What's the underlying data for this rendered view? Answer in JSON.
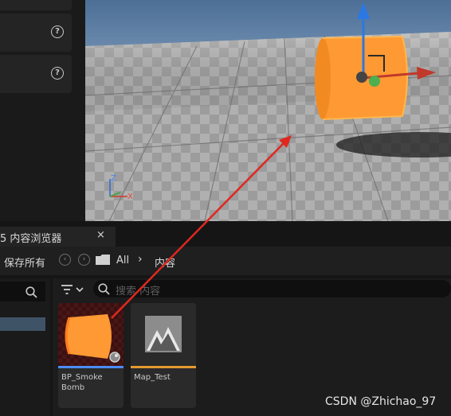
{
  "details_panel": {
    "help_glyph": "?"
  },
  "viewport": {
    "axis_z": "Z",
    "axis_x": "X"
  },
  "content_browser": {
    "tab_label": "5 内容浏览器",
    "close_glyph": "×",
    "save_all": "保存所有",
    "breadcrumb": [
      "All",
      "内容"
    ],
    "breadcrumb_separator": "›",
    "search_placeholder": "搜索 内容",
    "assets": [
      {
        "name": "BP_Smoke Bomb",
        "type": "blueprint",
        "bar_color": "#4a8cff"
      },
      {
        "name": "Map_Test",
        "type": "level",
        "bar_color": "#e39a2f"
      }
    ]
  },
  "watermark": "CSDN @Zhichao_97",
  "colors": {
    "accent_orange": "#ff9933",
    "annotation_arrow": "#e0281f",
    "sky": "#5b7fa8"
  }
}
